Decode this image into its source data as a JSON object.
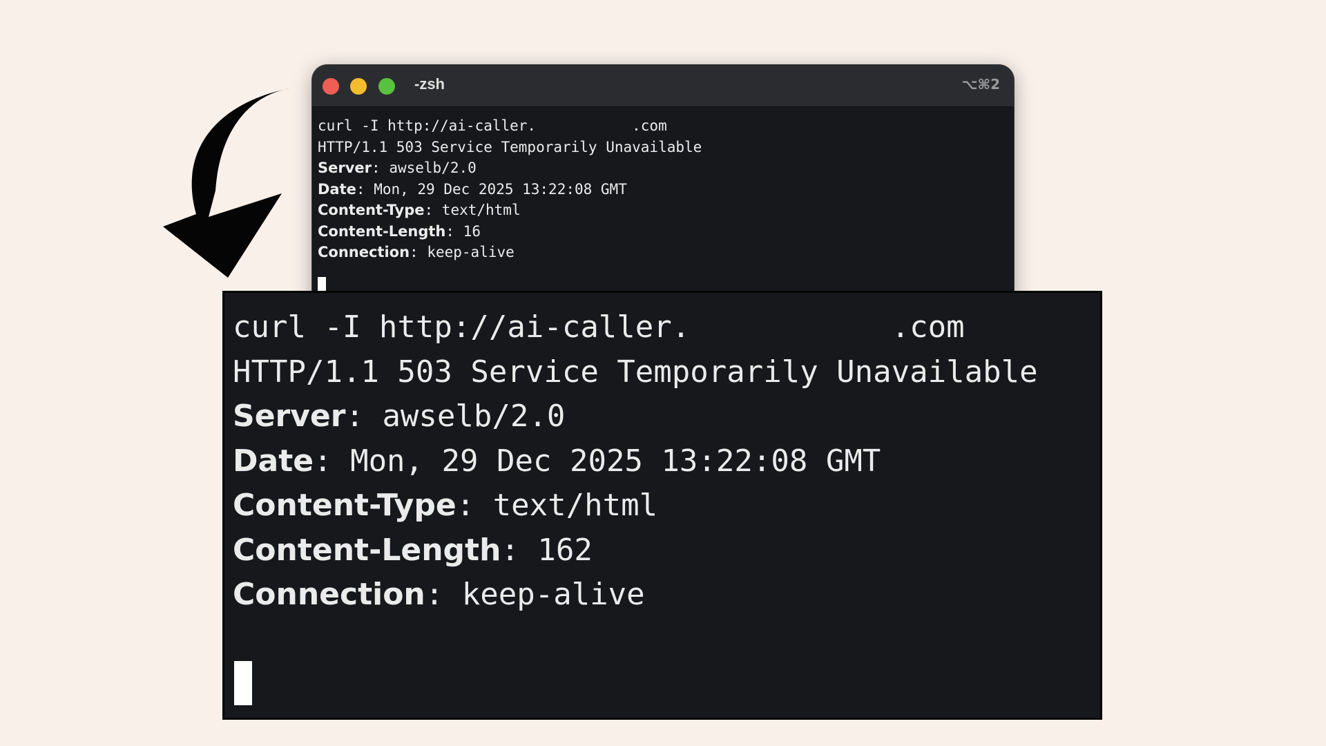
{
  "window": {
    "title": "-zsh",
    "shortcut": "⌥⌘2",
    "traffic_lights": {
      "close": "#ee5e55",
      "minimize": "#f4bd2f",
      "zoom": "#58c13f"
    }
  },
  "terminal": {
    "command": "curl -I http://ai-caller.           .com",
    "status_line": "HTTP/1.1 503 Service Temporarily Unavailable",
    "headers": [
      {
        "key": "Server",
        "value": "awselb/2.0"
      },
      {
        "key": "Date",
        "value": "Mon, 29 Dec 2025 13:22:08 GMT"
      },
      {
        "key": "Content-Type",
        "value": "text/html"
      },
      {
        "key": "Content-Length",
        "value": "16"
      },
      {
        "key": "Connection",
        "value": "keep-alive"
      }
    ]
  },
  "zoom": {
    "command": "curl -I http://ai-caller.           .com",
    "status_line": "HTTP/1.1 503 Service Temporarily Unavailable",
    "headers": [
      {
        "key": "Server",
        "value": "awselb/2.0"
      },
      {
        "key": "Date",
        "value": "Mon, 29 Dec 2025 13:22:08 GMT"
      },
      {
        "key": "Content-Type",
        "value": "text/html"
      },
      {
        "key": "Content-Length",
        "value": "162"
      },
      {
        "key": "Connection",
        "value": "keep-alive"
      }
    ]
  },
  "colors": {
    "background": "#faf0ea",
    "terminal_bg": "#16181c",
    "text": "#ececec"
  },
  "icons": {
    "arrow": "curved-down-arrow-icon"
  }
}
